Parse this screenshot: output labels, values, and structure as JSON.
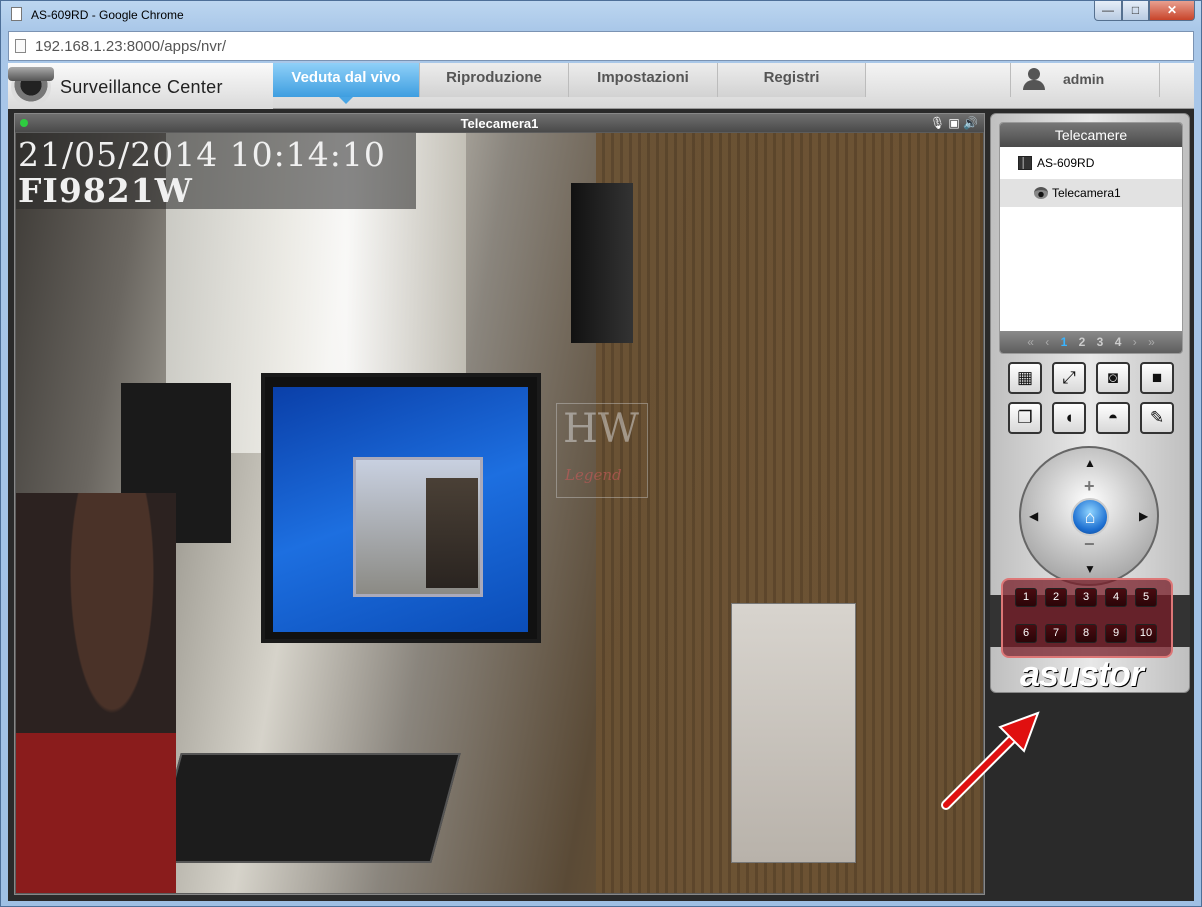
{
  "window": {
    "title": "AS-609RD - Google Chrome",
    "minimize": "—",
    "maximize": "□",
    "close": "✕"
  },
  "address_bar": {
    "url": "192.168.1.23:8000/apps/nvr/"
  },
  "app": {
    "brand": "Surveillance Center",
    "tabs": [
      {
        "label": "Veduta dal vivo",
        "active": true
      },
      {
        "label": "Riproduzione",
        "active": false
      },
      {
        "label": "Impostazioni",
        "active": false
      },
      {
        "label": "Registri",
        "active": false
      }
    ],
    "user": "admin"
  },
  "live_view": {
    "camera_title": "Telecamera1",
    "osd_datetime": "21/05/2014 10:14:10",
    "osd_model": "FI9821W",
    "watermark_top": "HW",
    "watermark_bottom": "Legend",
    "status_icons": "🎙 ▣ 🔊"
  },
  "sidebar": {
    "panel_title": "Telecamere",
    "tree": [
      {
        "label": "AS-609RD",
        "type": "nas"
      },
      {
        "label": "Telecamera1",
        "type": "camera"
      }
    ],
    "pager": {
      "first": "«",
      "prev": "‹",
      "pages": [
        "1",
        "2",
        "3",
        "4"
      ],
      "current": "1",
      "next": "›",
      "last": "»"
    },
    "tool_buttons": [
      {
        "name": "layout-icon",
        "glyph": "▦"
      },
      {
        "name": "fullscreen-icon",
        "glyph": "⤢"
      },
      {
        "name": "snapshot-icon",
        "glyph": "◙"
      },
      {
        "name": "record-icon",
        "glyph": "■"
      },
      {
        "name": "multi-copy-icon",
        "glyph": "❐"
      },
      {
        "name": "audio-icon",
        "glyph": "◖"
      },
      {
        "name": "dome-camera-icon",
        "glyph": "◓"
      },
      {
        "name": "settings-wrench-icon",
        "glyph": "✎"
      }
    ],
    "ptz": {
      "up": "▲",
      "down": "▼",
      "left": "◀",
      "right": "▶",
      "zoom_in": "+",
      "zoom_out": "−",
      "home": "⌂"
    },
    "presets": [
      "1",
      "2",
      "3",
      "4",
      "5",
      "6",
      "7",
      "8",
      "9",
      "10"
    ],
    "brand_logo": "asustor"
  },
  "colors": {
    "active_tab": "#3e9ee0",
    "preset_highlight": "#d77777",
    "annotation_arrow": "#e01010"
  }
}
